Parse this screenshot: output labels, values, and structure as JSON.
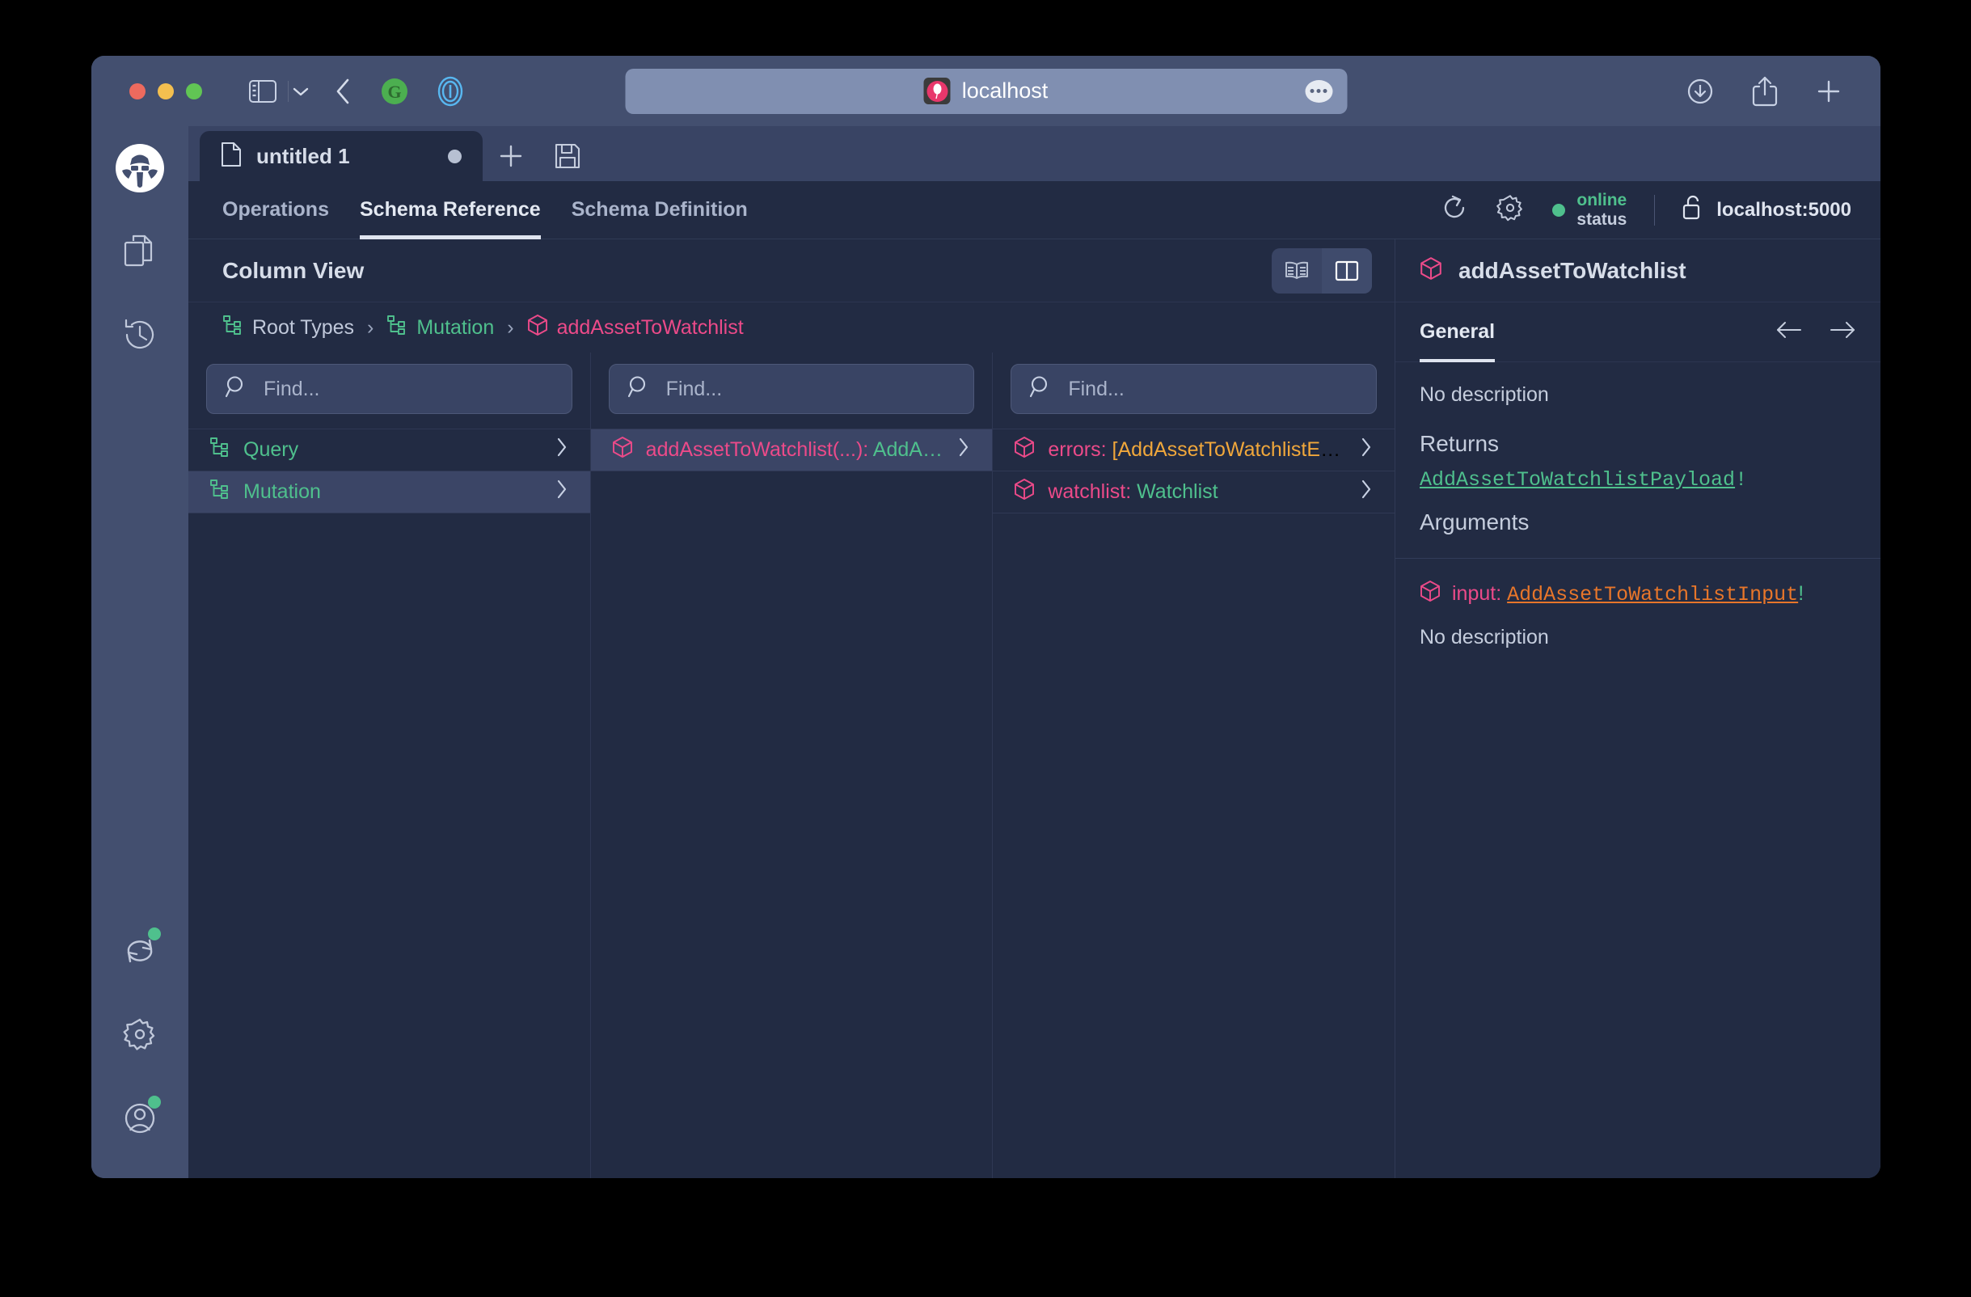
{
  "browser": {
    "url": "localhost",
    "favicon_name": "altair-graphql-favicon",
    "traffic_lights": [
      "close",
      "minimize",
      "maximize"
    ],
    "toolbar_icons": [
      "sidebar-toggle-icon",
      "chevron-down-icon",
      "back-icon",
      "grammarly-icon",
      "onepassword-icon"
    ],
    "right_icons": [
      "downloads-icon",
      "share-icon",
      "new-tab-icon"
    ],
    "more_button": "url-more-button"
  },
  "rail": {
    "logo_name": "altair-logo",
    "items": [
      {
        "name": "documents-icon",
        "badge": false
      },
      {
        "name": "history-icon",
        "badge": false
      }
    ],
    "bottom_items": [
      {
        "name": "refresh-icon",
        "badge": true
      },
      {
        "name": "settings-gear-icon",
        "badge": false
      },
      {
        "name": "account-icon",
        "badge": true
      }
    ]
  },
  "window_tabs": {
    "tabs": [
      {
        "label": "untitled 1",
        "icon": "file-icon",
        "dirty": true
      }
    ],
    "add_label": "+",
    "save_icon": "save-disk-icon"
  },
  "nav": {
    "tabs": [
      {
        "label": "Operations",
        "active": false
      },
      {
        "label": "Schema Reference",
        "active": true
      },
      {
        "label": "Schema Definition",
        "active": false
      }
    ],
    "reload_icon": "reload-icon",
    "settings_icon": "gear-icon",
    "status": {
      "label": "online",
      "sub": "status",
      "color": "#4fc08d"
    },
    "lock_icon": "unlocked-padlock-icon",
    "host": "localhost:5000"
  },
  "docs": {
    "title": "Column View",
    "view_toggle": [
      {
        "name": "book-view-button",
        "active": false
      },
      {
        "name": "column-view-button",
        "active": true
      }
    ],
    "breadcrumb": [
      {
        "label": "Root Types",
        "color": "muted",
        "icon": "sitemap-icon"
      },
      {
        "label": "Mutation",
        "color": "green",
        "icon": "sitemap-icon"
      },
      {
        "label": "addAssetToWatchlist",
        "color": "pink",
        "icon": "cube-icon"
      }
    ],
    "columns": [
      {
        "search_placeholder": "Find...",
        "search_value": "",
        "rows": [
          {
            "icon": "sitemap-icon",
            "parts": [
              {
                "text": "Query",
                "color": "green"
              }
            ],
            "selected": false
          },
          {
            "icon": "sitemap-icon",
            "parts": [
              {
                "text": "Mutation",
                "color": "green"
              }
            ],
            "selected": true
          }
        ]
      },
      {
        "search_placeholder": "Find...",
        "search_value": "",
        "rows": [
          {
            "icon": "cube-icon",
            "parts": [
              {
                "text": "addAssetToWatchlist(...)",
                "color": "pink"
              },
              {
                "text": ": ",
                "color": "pink"
              },
              {
                "text": "AddA…",
                "color": "green"
              }
            ],
            "selected": true
          }
        ]
      },
      {
        "search_placeholder": "Find...",
        "search_value": "",
        "rows": [
          {
            "icon": "cube-icon",
            "parts": [
              {
                "text": "errors",
                "color": "pink"
              },
              {
                "text": ": ",
                "color": "pink"
              },
              {
                "text": "[AddAssetToWatchlistEr…",
                "color": "orange"
              }
            ],
            "selected": false
          },
          {
            "icon": "cube-icon",
            "parts": [
              {
                "text": "watchlist",
                "color": "pink"
              },
              {
                "text": ": ",
                "color": "pink"
              },
              {
                "text": "Watchlist",
                "color": "green"
              }
            ],
            "selected": false
          }
        ]
      }
    ]
  },
  "detail": {
    "icon": "cube-icon",
    "title": "addAssetToWatchlist",
    "tabs": [
      {
        "label": "General",
        "active": true
      }
    ],
    "prev_icon": "arrow-left-icon",
    "next_icon": "arrow-right-icon",
    "description": "No description",
    "returns_heading": "Returns",
    "returns_type": "AddAssetToWatchlistPayload",
    "returns_bang": "!",
    "arguments_heading": "Arguments",
    "argument": {
      "icon": "cube-icon",
      "name": "input",
      "colon": ": ",
      "type": "AddAssetToWatchlistInput",
      "bang": "!",
      "description": "No description"
    }
  }
}
